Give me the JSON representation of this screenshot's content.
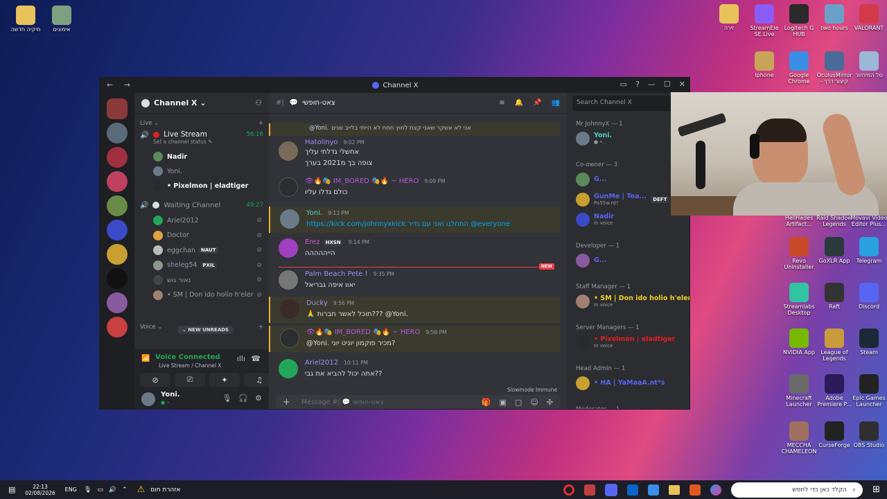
{
  "desktop": {
    "icons_left": [
      {
        "label": "תיקיה חדשה",
        "icon": "folder-icon",
        "color": "#e8c25a"
      },
      {
        "label": "אימונים",
        "icon": "video-file-icon",
        "color": "#7fa080"
      }
    ],
    "icons_right": [
      {
        "label": "זירה",
        "icon": "folder-icon",
        "color": "#e8c25a"
      },
      {
        "label": "StreamEle SE.Live",
        "icon": "streamelements-icon",
        "color": "#8b5cf6"
      },
      {
        "label": "Logitech G HUB",
        "icon": "logitech-icon",
        "color": "#2a2a2a"
      },
      {
        "label": "two hours",
        "icon": "image-icon",
        "color": "#6aa0c8"
      },
      {
        "label": "VALORANT",
        "icon": "valorant-icon",
        "color": "#d23a4a"
      },
      {
        "label": "Iphone",
        "icon": "folder-icon",
        "color": "#c9a35a"
      },
      {
        "label": "Google Chrome",
        "icon": "chrome-icon",
        "color": "#3a8ee6"
      },
      {
        "label": "OculusMirror - קיצור דרך",
        "icon": "oculus-icon",
        "color": "#4a6a9a"
      },
      {
        "label": "סל המיחזור",
        "icon": "recycle-bin-icon",
        "color": "#9bb8d8"
      },
      {
        "label": "HellHades Artifact...",
        "icon": "app-icon",
        "color": "#444"
      },
      {
        "label": "Raid Shadow Legends",
        "icon": "raid-icon",
        "color": "#555"
      },
      {
        "label": "Movavi Video Editor Plus...",
        "icon": "movavi-icon",
        "color": "#3a6ad8"
      },
      {
        "label": "Revo Uninstaller",
        "icon": "revo-icon",
        "color": "#c84a2a"
      },
      {
        "label": "GoXLR App",
        "icon": "goxlr-icon",
        "color": "#2a3a3a"
      },
      {
        "label": "Telegram",
        "icon": "telegram-icon",
        "color": "#2aa0e0"
      },
      {
        "label": "Streamlabs Desktop",
        "icon": "streamlabs-icon",
        "color": "#31c3a2"
      },
      {
        "label": "Raft",
        "icon": "raft-icon",
        "color": "#333"
      },
      {
        "label": "Discord",
        "icon": "discord-icon",
        "color": "#5865f2"
      },
      {
        "label": "NVIDIA App",
        "icon": "nvidia-icon",
        "color": "#76b900"
      },
      {
        "label": "League of Legends",
        "icon": "lol-icon",
        "color": "#c89b3c"
      },
      {
        "label": "Steam",
        "icon": "steam-icon",
        "color": "#1b2838"
      },
      {
        "label": "Minecraft Launcher",
        "icon": "minecraft-icon",
        "color": "#6a6a6a"
      },
      {
        "label": "Adobe Premiere P...",
        "icon": "premiere-icon",
        "color": "#2a1a5a"
      },
      {
        "label": "Epic Games Launcher",
        "icon": "epic-icon",
        "color": "#222"
      },
      {
        "label": "MECCHA CHAMELEON",
        "icon": "game-icon",
        "color": "#a07060"
      },
      {
        "label": "CurseForge",
        "icon": "curseforge-icon",
        "color": "#222"
      },
      {
        "label": "OBS Studio",
        "icon": "obs-icon",
        "color": "#302e31"
      }
    ]
  },
  "window": {
    "title": "Channel X",
    "nav": "← →"
  },
  "guild_colors": [
    "#8a3a3a",
    "#5a6a7a",
    "#a03040",
    "#c04060",
    "#6a8a4a",
    "#3a4ac8",
    "#c8a030",
    "#111",
    "#8a5aa0",
    "#c84040"
  ],
  "channel_sidebar": {
    "server_name": "Channel X ⌄",
    "live_label": "Live ⌄",
    "voice_label": "Voice ⌄",
    "live_stream": {
      "name": "Live Stream",
      "time": "56:16",
      "status": "Set a channel status ✎"
    },
    "live_members": [
      {
        "name": "Nadir",
        "color": "#f2f3f5",
        "badge": "",
        "av": "#5a8a5a"
      },
      {
        "name": "Yoni.",
        "color": "#949ba4",
        "badge": "",
        "av": "#6a7a8a"
      },
      {
        "name": "• Pixelmon | eladtiger",
        "color": "#f2f3f5",
        "badge": "",
        "av": "#2a2a2a"
      }
    ],
    "waiting": {
      "name": "Waiting Channel",
      "time": "49:27"
    },
    "waiting_members": [
      {
        "name": "Ariel2012",
        "badge": "",
        "av": "#23a55a"
      },
      {
        "name": "Doctor",
        "badge": "",
        "av": "#e0a040"
      },
      {
        "name": "eggchan",
        "badge": "NAUT",
        "av": "#bbb"
      },
      {
        "name": "sheleg54",
        "badge": "PXIL",
        "av": "#8a9a8a"
      },
      {
        "name": "נאור גוש",
        "badge": "",
        "av": "#444"
      },
      {
        "name": "• SM | Don ido holio h'eler",
        "badge": "",
        "av": "#a08070"
      }
    ],
    "new_unreads": "⌄ NEW UNREADS",
    "voice_connected": {
      "title": "Voice Connected",
      "sub": "Live Stream / Channel X"
    },
    "user": {
      "name": "Yoni.",
      "status": "● •."
    }
  },
  "chat": {
    "channel": "צאט-חופשי",
    "placeholder": "Message #| 💬 צאט-חופשי",
    "slowmode": "Slowmode Immune",
    "new_badge": "NEW",
    "messages": [
      {
        "author": "@Yoni.",
        "time": "",
        "author_color": "#c9cdfb",
        "text": "אני לא אשקר שאני קצת לחוץ חחח לא הייתי בלייב שנים",
        "av": "",
        "hl": true
      },
      {
        "author": "Hatolinyo",
        "time": "9:02 PM",
        "author_color": "#a48cf0",
        "text": "אחשלי גדלתי עליך",
        "text2": "צופה בך מ2021 בערך",
        "av": "#7a6a5a",
        "hl": false
      },
      {
        "author": "👁🔥🎭 IM_BORED 🎭🔥 ~ HERO",
        "time": "9:09 PM",
        "author_color": "#b05ae0",
        "text": "כולם גדלו עליו",
        "av": "#2b2d31",
        "hl": false
      },
      {
        "author": "Yoni.",
        "time": "9:13 PM",
        "author_color": "#4fd1c5",
        "text": "https://kick.com/johnnyxkick התחלנו ואני עם נדיר @everyone",
        "av": "#6a7a8a",
        "hl": true
      },
      {
        "author": "Erez",
        "time": "9:14 PM",
        "author_color": "#d05ad0",
        "badge": "HXSN",
        "text": "הייההההה",
        "av": "#a040c0",
        "hl": false
      },
      {
        "author": "Palm Beach Pete !",
        "time": "9:35 PM",
        "author_color": "#a48cf0",
        "text": "יאוו איפה גבריאל",
        "av": "#777",
        "hl": false
      },
      {
        "author": "Ducky",
        "time": "9:56 PM",
        "author_color": "#a48cf0",
        "text": "🙏 תוכל לאשר חברות??? @Yoni.",
        "av": "#3a2a2a",
        "hl": true
      },
      {
        "author": "👁🔥🎭 IM_BORED 🎭🔥 ~ HERO",
        "time": "9:56 PM",
        "author_color": "#b05ae0",
        "text": "@Yoni. מכיר פוקמון יוניט יוני?",
        "av": "#2b2d31",
        "hl": true
      },
      {
        "author": "Ariel2012",
        "time": "10:11 PM",
        "author_color": "#a48cf0",
        "text": "אתה יכול להביא את גבי??",
        "av": "#23a55a",
        "hl": false
      }
    ]
  },
  "members": {
    "search": "Search Channel X",
    "roles": [
      {
        "role": "Mr JohnnyX — 1",
        "members": [
          {
            "name": "Yoni.",
            "sub": "● •.",
            "color": "#4fd1c5",
            "av": "#6a7a8a"
          }
        ]
      },
      {
        "role": "Co-owner — 3",
        "members": [
          {
            "name": "G...",
            "sub": "",
            "color": "#5865f2",
            "av": "#5a8a5a"
          },
          {
            "name": "GunMe | Tea...",
            "sub": "Pa55w.rd?",
            "color": "#5865f2",
            "av": "#c8a030",
            "badge": "DEFT"
          },
          {
            "name": "Nadir",
            "sub": "In voice",
            "color": "#5865f2",
            "av": "#3a4ac8"
          }
        ]
      },
      {
        "role": "Developer — 1",
        "members": [
          {
            "name": "G...",
            "sub": "",
            "color": "#5865f2",
            "av": "#8a5aa0"
          }
        ]
      },
      {
        "role": "Staff Manager — 1",
        "members": [
          {
            "name": "• SM | Don ido holio h'eler",
            "sub": "In voice",
            "color": "#f0d020",
            "av": "#a08070"
          }
        ]
      },
      {
        "role": "Server Managers — 1",
        "members": [
          {
            "name": "• Pixelmon | eladtiger",
            "sub": "In voice",
            "color": "#e02020",
            "av": "#2a2a2a"
          }
        ]
      },
      {
        "role": "Head Admin — 1",
        "members": [
          {
            "name": "• HA | YaMaaA.nt*s",
            "sub": "",
            "color": "#5865f2",
            "av": "#c8a030"
          }
        ]
      },
      {
        "role": "Moderator — 1",
        "members": []
      }
    ]
  },
  "taskbar": {
    "time": "22:13",
    "date": "02/08/2026",
    "lang": "ENG",
    "weather": "אזהרת חום",
    "search": "הקלד כאן כדי לחפש"
  }
}
